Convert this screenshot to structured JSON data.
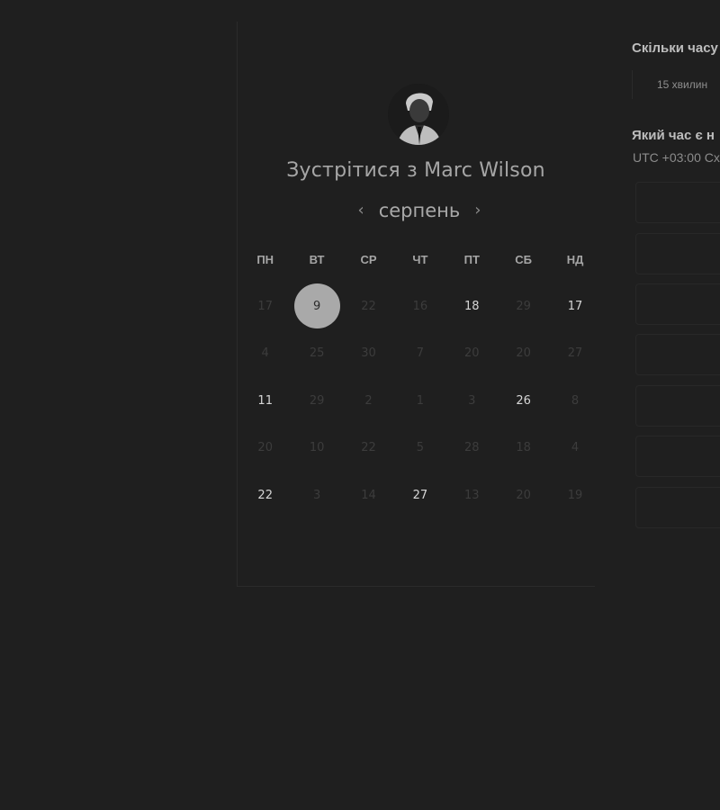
{
  "header": {
    "avatar_label": "Marc Wilson avatar",
    "title": "Зустрітися з Marc Wilson"
  },
  "calendar": {
    "month": "серпень",
    "prev_icon": "chevron-left-icon",
    "next_icon": "chevron-right-icon",
    "weekdays": [
      "ПН",
      "ВТ",
      "СР",
      "ЧТ",
      "ПТ",
      "СБ",
      "НД"
    ],
    "weeks": [
      [
        {
          "d": "17",
          "s": "disabled"
        },
        {
          "d": "9",
          "s": "selected"
        },
        {
          "d": "22",
          "s": "disabled"
        },
        {
          "d": "16",
          "s": "disabled"
        },
        {
          "d": "18",
          "s": "available"
        },
        {
          "d": "29",
          "s": "disabled"
        },
        {
          "d": "17",
          "s": "available"
        }
      ],
      [
        {
          "d": "4",
          "s": "disabled"
        },
        {
          "d": "25",
          "s": "disabled"
        },
        {
          "d": "30",
          "s": "disabled"
        },
        {
          "d": "7",
          "s": "disabled"
        },
        {
          "d": "20",
          "s": "disabled"
        },
        {
          "d": "20",
          "s": "disabled"
        },
        {
          "d": "27",
          "s": "disabled"
        }
      ],
      [
        {
          "d": "11",
          "s": "available"
        },
        {
          "d": "29",
          "s": "disabled"
        },
        {
          "d": "2",
          "s": "disabled"
        },
        {
          "d": "1",
          "s": "disabled"
        },
        {
          "d": "3",
          "s": "disabled"
        },
        {
          "d": "26",
          "s": "available"
        },
        {
          "d": "8",
          "s": "disabled"
        }
      ],
      [
        {
          "d": "20",
          "s": "disabled"
        },
        {
          "d": "10",
          "s": "disabled"
        },
        {
          "d": "22",
          "s": "disabled"
        },
        {
          "d": "5",
          "s": "disabled"
        },
        {
          "d": "28",
          "s": "disabled"
        },
        {
          "d": "18",
          "s": "disabled"
        },
        {
          "d": "4",
          "s": "disabled"
        }
      ],
      [
        {
          "d": "22",
          "s": "available"
        },
        {
          "d": "3",
          "s": "disabled"
        },
        {
          "d": "14",
          "s": "disabled"
        },
        {
          "d": "27",
          "s": "available"
        },
        {
          "d": "13",
          "s": "disabled"
        },
        {
          "d": "20",
          "s": "disabled"
        },
        {
          "d": "19",
          "s": "disabled"
        }
      ]
    ]
  },
  "sidebar": {
    "duration_question": "Скільки часу",
    "duration_option": "15 хвилин",
    "time_question": "Який час є н",
    "timezone": "UTC +03:00 Сх"
  },
  "colors": {
    "background": "#1f1f1f",
    "selected_day_bg": "#a9a9a9",
    "available_day": "#d6d6d6",
    "disabled_day": "#3c3c3c"
  }
}
